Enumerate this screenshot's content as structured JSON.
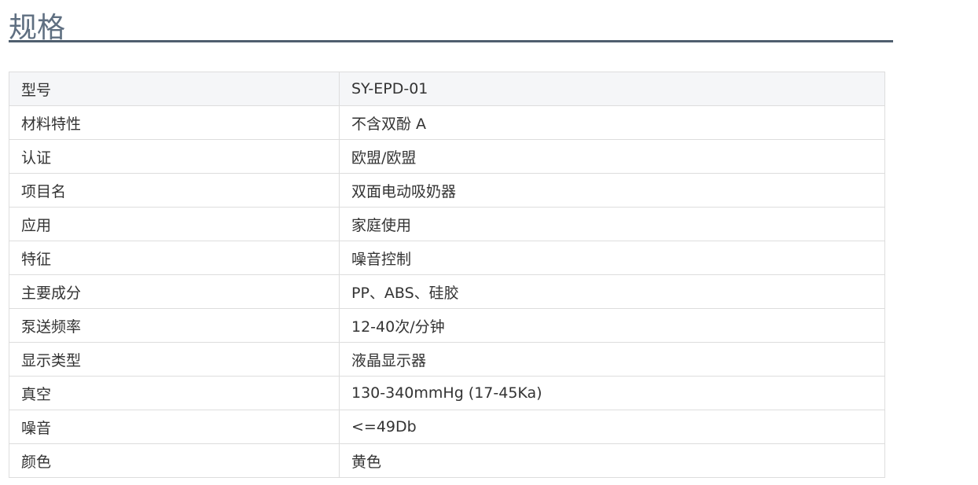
{
  "spec": {
    "title": "规格",
    "rows": [
      {
        "label": "型号",
        "value": "SY-EPD-01"
      },
      {
        "label": "材料特性",
        "value": "不含双酚 A"
      },
      {
        "label": "认证",
        "value": "欧盟/欧盟"
      },
      {
        "label": "项目名",
        "value": "双面电动吸奶器"
      },
      {
        "label": "应用",
        "value": "家庭使用"
      },
      {
        "label": "特征",
        "value": "噪音控制"
      },
      {
        "label": "主要成分",
        "value": "PP、ABS、硅胶"
      },
      {
        "label": "泵送频率",
        "value": "12-40次/分钟"
      },
      {
        "label": "显示类型",
        "value": "液晶显示器"
      },
      {
        "label": "真空",
        "value": "130-340mmHg (17-45Ka)"
      },
      {
        "label": "噪音",
        "value": "<=49Db"
      },
      {
        "label": "颜色",
        "value": "黄色"
      }
    ]
  }
}
